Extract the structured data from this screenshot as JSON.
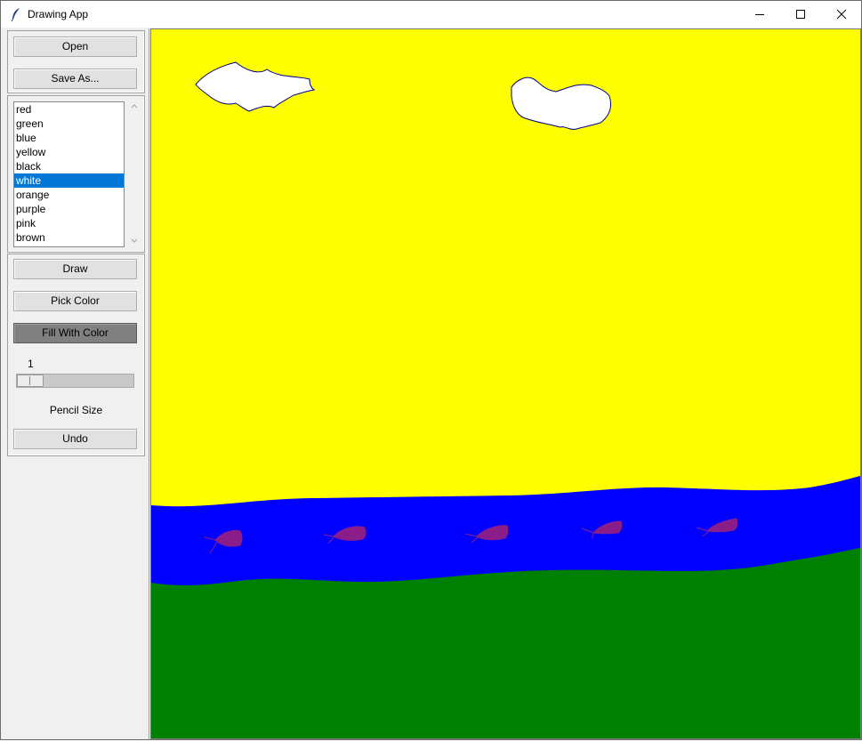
{
  "window": {
    "title": "Drawing App",
    "app_icon": "feather-icon"
  },
  "titlebar_controls": {
    "minimize": "minimize-icon",
    "maximize": "maximize-icon",
    "close": "close-icon"
  },
  "file_panel": {
    "open_label": "Open",
    "save_as_label": "Save As..."
  },
  "color_list": {
    "items": [
      "red",
      "green",
      "blue",
      "yellow",
      "black",
      "white",
      "orange",
      "purple",
      "pink",
      "brown"
    ],
    "selected": "white"
  },
  "tools": {
    "draw_label": "Draw",
    "pick_color_label": "Pick Color",
    "fill_label": "Fill With Color",
    "fill_active": true,
    "slider_value": "1",
    "slider_label": "Pencil Size",
    "undo_label": "Undo"
  },
  "colors": {
    "sky": "#ffff00",
    "water": "#0000ff",
    "grass": "#008000",
    "cloud": "#ffffff",
    "fish": "#8b1d8b",
    "list_selection": "#0078d7"
  }
}
